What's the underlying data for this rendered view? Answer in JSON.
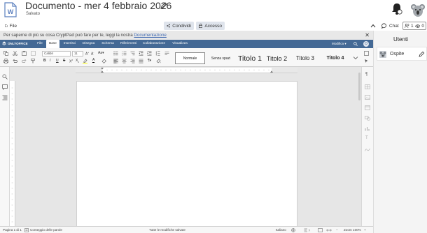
{
  "cryptpad": {
    "title": "Documento - mer 4 febbraio 2026",
    "status": "Salvato",
    "toolbar": {
      "file_label": "File",
      "share_label": "Condividi",
      "access_label": "Accesso",
      "chat_label": "Chat",
      "users_count": "1",
      "viewers_count": "0"
    },
    "notice": {
      "text": "Per saperne di più su cosa CryptPad può fare per te, leggi la nostra ",
      "link": "Documentazione",
      "close": "✕"
    },
    "user_panel": {
      "title": "Utenti",
      "users": [
        {
          "name": "Ospite"
        }
      ]
    }
  },
  "editor": {
    "logo": "ONLYOFFICE",
    "tabs": [
      {
        "label": "File",
        "active": false
      },
      {
        "label": "Base",
        "active": true
      },
      {
        "label": "Inserisci",
        "active": false
      },
      {
        "label": "Disegna",
        "active": false
      },
      {
        "label": "Schema",
        "active": false
      },
      {
        "label": "Riferimenti",
        "active": false
      },
      {
        "label": "Collaborazione",
        "active": false
      },
      {
        "label": "Visualizza",
        "active": false
      }
    ],
    "mode_label": "Modifica",
    "user_initial": "O",
    "font_name": "Calibri",
    "font_size": "11",
    "styles": [
      {
        "label": "Normale"
      },
      {
        "label": "Senza spazi"
      },
      {
        "label": "Titolo 1"
      },
      {
        "label": "Titolo 2"
      },
      {
        "label": "Titolo 3"
      },
      {
        "label": "Titolo 4"
      }
    ],
    "status_bar": {
      "page": "Pagina 1 di 1",
      "word_count": "Conteggio delle parole",
      "saved": "Tutte le modifiche salvate",
      "language": "Italiano",
      "zoom": "Zoom 100%"
    }
  },
  "colors": {
    "onlyoffice_header": "#446995",
    "accent_button": "#dfe4ec",
    "link": "#3b66b0"
  }
}
